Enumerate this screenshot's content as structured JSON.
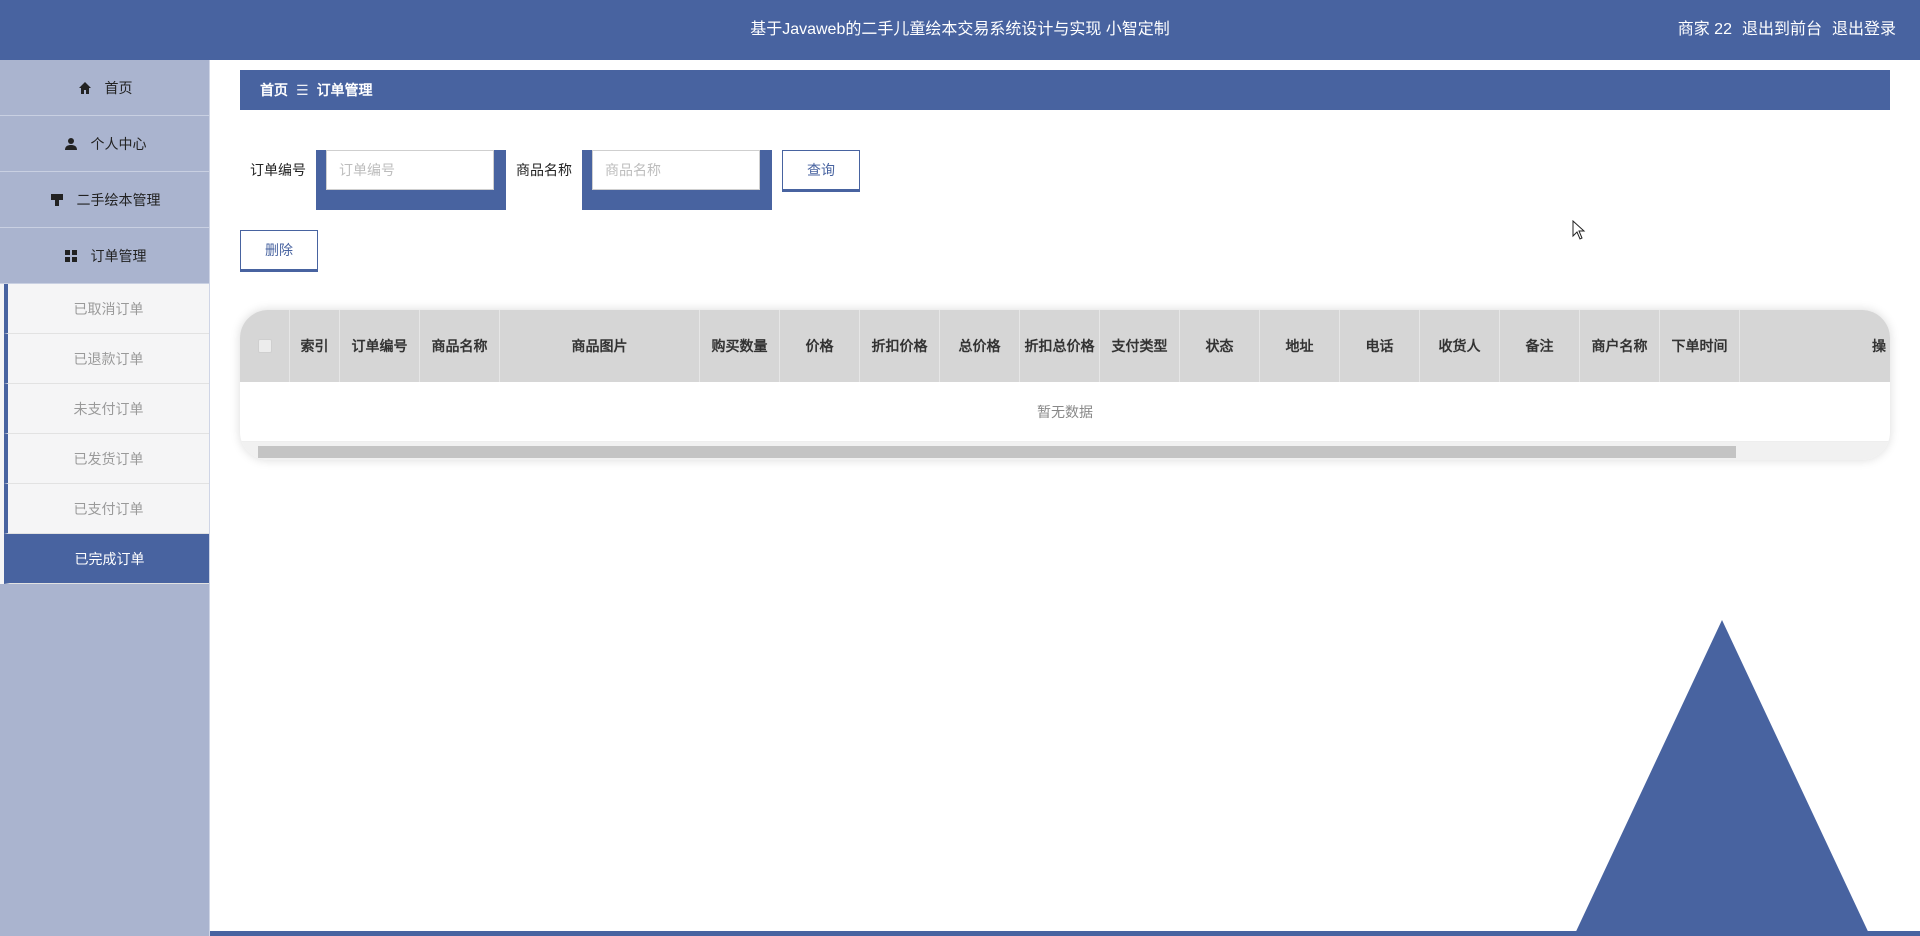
{
  "header": {
    "title": "基于Javaweb的二手儿童绘本交易系统设计与实现 小智定制",
    "user": "商家 22",
    "back_to_front": "退出到前台",
    "logout": "退出登录"
  },
  "sidebar": {
    "items": [
      {
        "label": "首页",
        "icon": "home-icon"
      },
      {
        "label": "个人中心",
        "icon": "user-icon"
      },
      {
        "label": "二手绘本管理",
        "icon": "paint-brush-icon"
      },
      {
        "label": "订单管理",
        "icon": "grid-icon"
      }
    ],
    "sub_items": [
      {
        "label": "已取消订单"
      },
      {
        "label": "已退款订单"
      },
      {
        "label": "未支付订单"
      },
      {
        "label": "已发货订单"
      },
      {
        "label": "已支付订单"
      },
      {
        "label": "已完成订单",
        "active": true
      }
    ]
  },
  "breadcrumb": {
    "home": "首页",
    "separator": "☰",
    "current": "订单管理"
  },
  "search": {
    "order_no_label": "订单编号",
    "order_no_placeholder": "订单编号",
    "order_no_value": "",
    "goods_name_label": "商品名称",
    "goods_name_placeholder": "商品名称",
    "goods_name_value": "",
    "query_button": "查询"
  },
  "actions": {
    "delete_button": "删除"
  },
  "table": {
    "columns": [
      "索引",
      "订单编号",
      "商品名称",
      "商品图片",
      "购买数量",
      "价格",
      "折扣价格",
      "总价格",
      "折扣总价格",
      "支付类型",
      "状态",
      "地址",
      "电话",
      "收货人",
      "备注",
      "商户名称",
      "下单时间",
      "操"
    ],
    "empty_text": "暂无数据"
  },
  "colors": {
    "primary": "#4863a0",
    "sidebar_bg": "#aab4cf",
    "table_header_bg": "#d6d6d6"
  }
}
